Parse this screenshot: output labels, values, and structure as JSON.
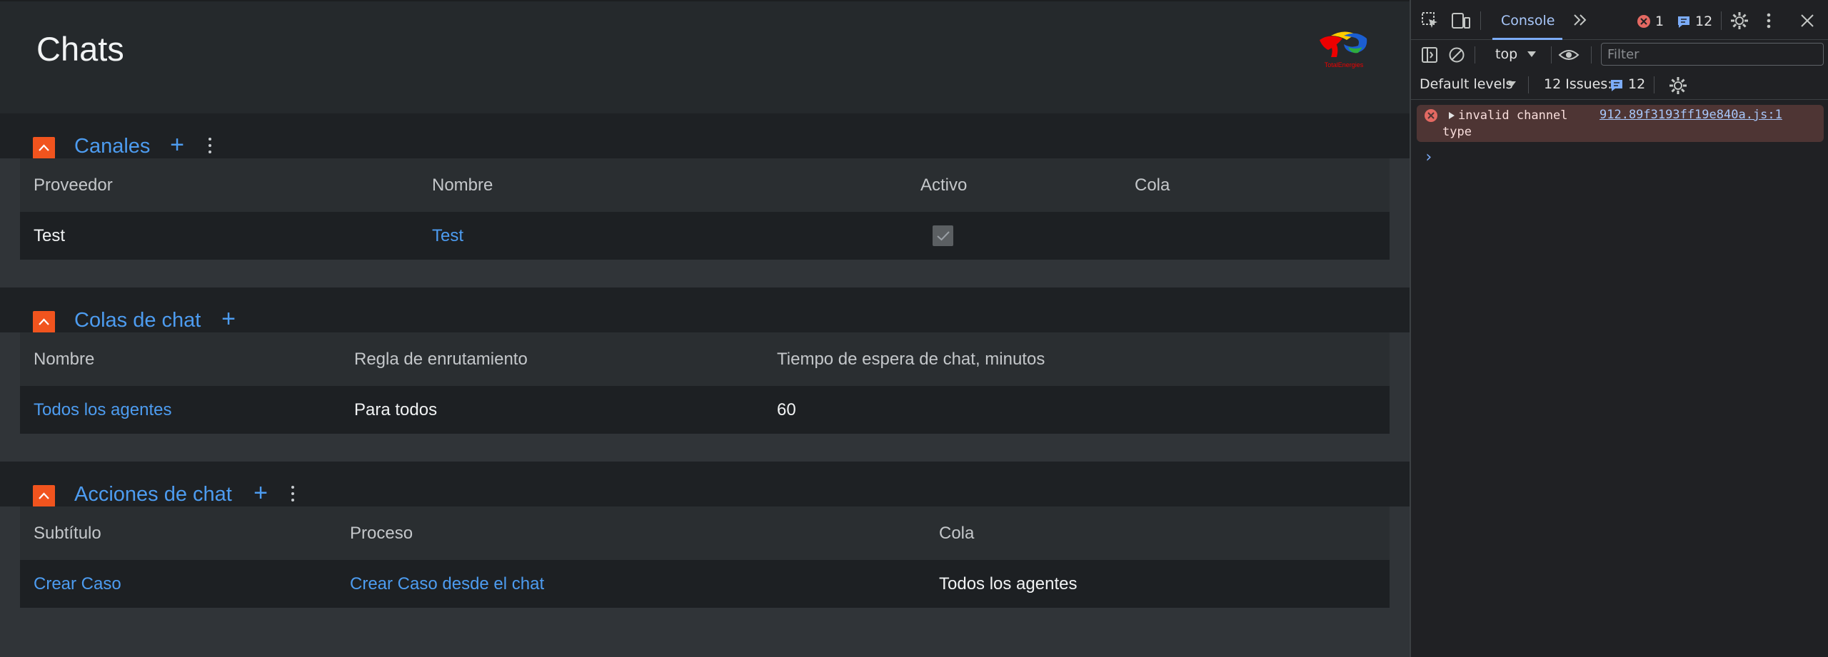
{
  "app": {
    "title": "Chats",
    "logo_text": "TotalEnergies",
    "colors": {
      "accent": "#4d9cf0",
      "collapse": "#f1541e"
    }
  },
  "channels": {
    "title": "Canales",
    "columns": [
      "Proveedor",
      "Nombre",
      "Activo",
      "Cola"
    ],
    "rows": [
      {
        "provider": "Test",
        "name": "Test",
        "active": true,
        "queue": ""
      }
    ]
  },
  "queues": {
    "title": "Colas de chat",
    "columns": [
      "Nombre",
      "Regla de enrutamiento",
      "Tiempo de espera de chat, minutos"
    ],
    "rows": [
      {
        "name": "Todos los agentes",
        "rule": "Para todos",
        "wait": "60"
      }
    ]
  },
  "actions": {
    "title": "Acciones de chat",
    "columns": [
      "Subtítulo",
      "Proceso",
      "Cola"
    ],
    "rows": [
      {
        "subtitle": "Crear Caso",
        "process": "Crear Caso desde el chat",
        "queue": "Todos los agentes"
      }
    ]
  },
  "devtools": {
    "tab": "Console",
    "error_count": "1",
    "message_count": "12",
    "context": "top",
    "filter_placeholder": "Filter",
    "levels": "Default levels",
    "issues_label": "12 Issues:",
    "issues_count": "12",
    "error": {
      "message_line1": "invalid channel",
      "message_line2": "type",
      "source": "912.89f3193ff19e840a.js:1"
    },
    "prompt": "›"
  }
}
